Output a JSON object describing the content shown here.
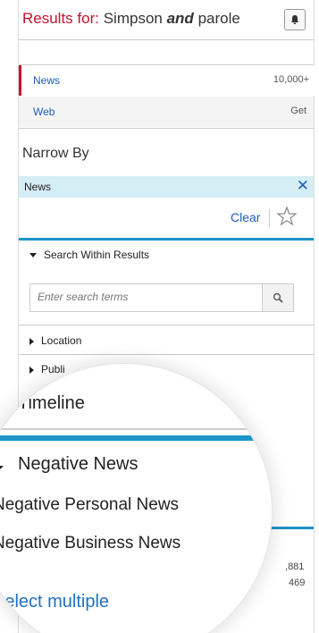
{
  "header": {
    "prefix": "Results for:",
    "query_a": "Simpson",
    "query_op": "and",
    "query_b": "parole"
  },
  "sources": [
    {
      "label": "News",
      "count": "10,000+"
    },
    {
      "label": "Web",
      "count": "Get"
    }
  ],
  "narrow_by": {
    "title": "Narrow By",
    "filter_tag": "News",
    "clear_label": "Clear"
  },
  "facets": {
    "search_within": "Search Within Results",
    "search_placeholder": "Enter search terms",
    "location": "Location",
    "publication_partial": "Publi",
    "count_a": "881",
    "count_a_prefix": ",",
    "count_b": "469"
  },
  "magnifier": {
    "timeline": "Timeline",
    "negative_news": "Negative News",
    "negative_personal": "Negative Personal News",
    "negative_business": "Negative Business News",
    "select_multiple": "Select multiple"
  },
  "colors": {
    "accent_red": "#c8102e",
    "link_blue": "#1f5cbf",
    "bar_blue": "#1f94c8",
    "tag_bg": "#d5edf5"
  }
}
